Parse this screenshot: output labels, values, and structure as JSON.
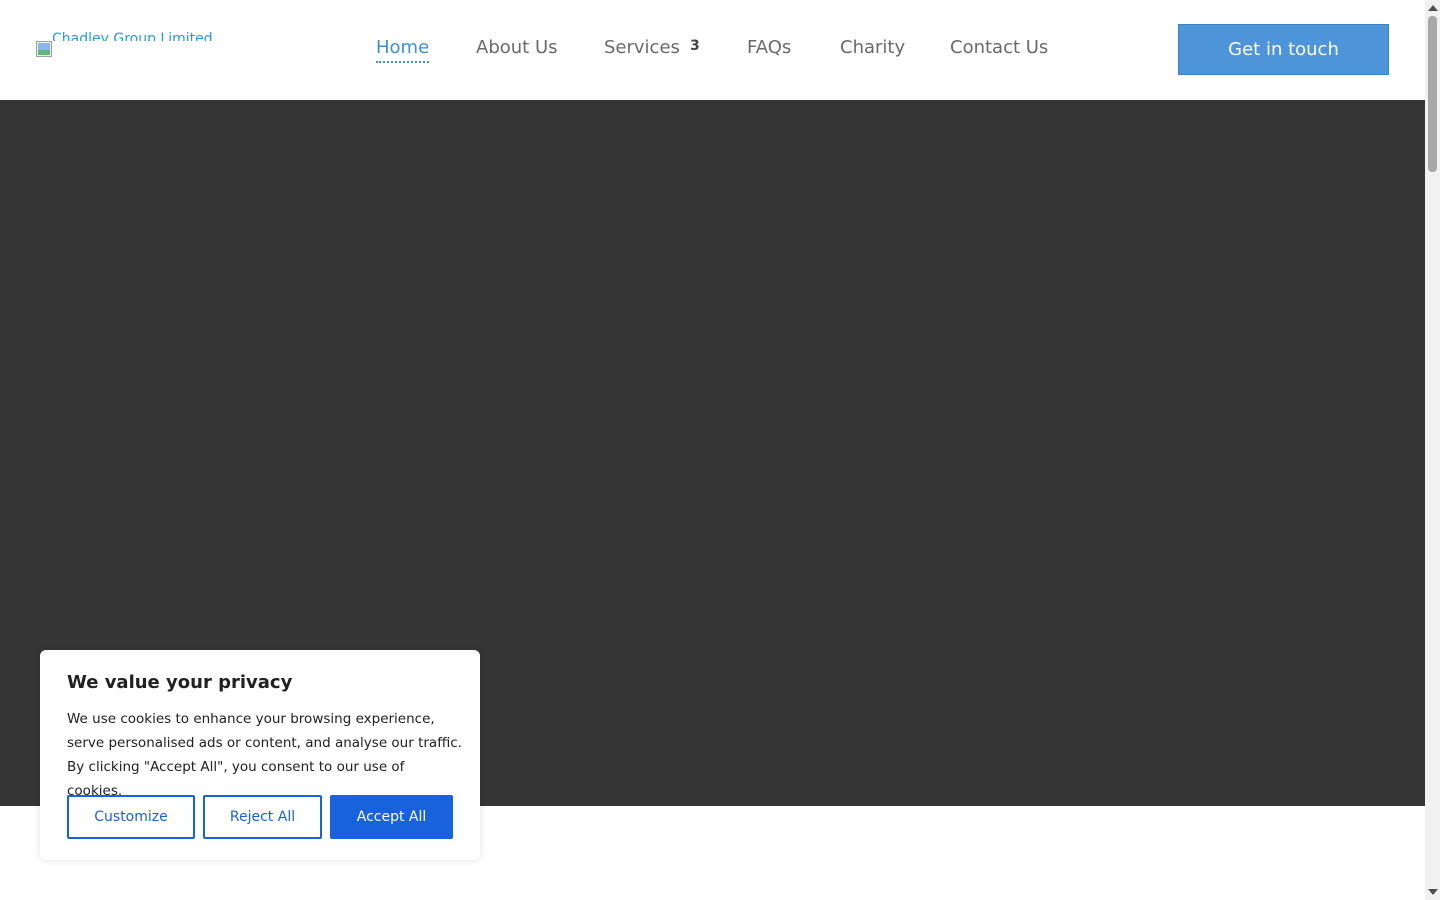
{
  "logo": {
    "alt_text": "Chadley Group Limited",
    "icon": "broken-image-icon"
  },
  "nav": {
    "items": [
      {
        "label": "Home",
        "active": true
      },
      {
        "label": "About Us"
      },
      {
        "label": "Services",
        "badge": "3"
      },
      {
        "label": "FAQs"
      },
      {
        "label": "Charity"
      },
      {
        "label": "Contact Us"
      }
    ]
  },
  "header": {
    "cta_label": "Get in touch"
  },
  "cookie_banner": {
    "title": "We value your privacy",
    "body": "We use cookies to enhance your browsing experience, serve personalised ads or content, and analyse our traffic. By clicking \"Accept All\", you consent to our use of cookies.",
    "customize_label": "Customize",
    "reject_label": "Reject All",
    "accept_label": "Accept All"
  },
  "colors": {
    "accent": "#4d94d8",
    "nav_active": "#3d8fd6",
    "hero_bg": "#353535",
    "cookie_primary": "#1863dc"
  }
}
